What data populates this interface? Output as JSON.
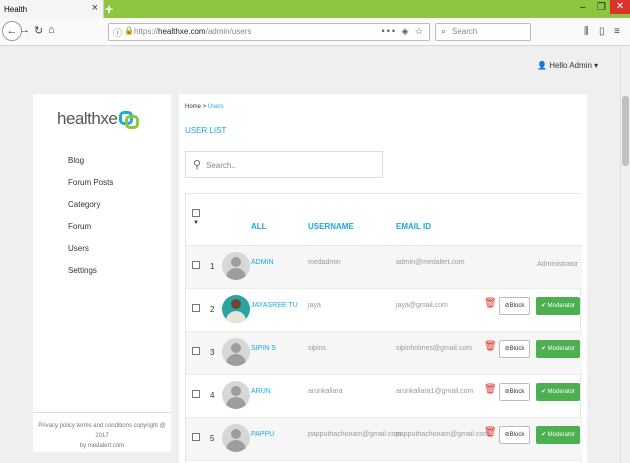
{
  "browser": {
    "tab_title": "Health",
    "tab_close": "×",
    "new_tab": "+",
    "url_prefix": "https://",
    "url_host": "healthxe.com",
    "url_path": "/admin/users",
    "url_actions": "••• ◈ ☆",
    "search_placeholder": "Search"
  },
  "header": {
    "greeting": "Hello Admin"
  },
  "sidebar": {
    "logo_text": "health",
    "logo_text_accent": "xe",
    "items": [
      {
        "label": "Blog"
      },
      {
        "label": "Forum Posts"
      },
      {
        "label": "Category"
      },
      {
        "label": "Forum"
      },
      {
        "label": "Users"
      },
      {
        "label": "Settings"
      }
    ],
    "footer_line1": "Privacy policy terms and conditions copyright @ 2017",
    "footer_line2": "by medalert.com"
  },
  "main": {
    "breadcrumb_home": "Home",
    "breadcrumb_sep": " > ",
    "breadcrumb_current": "Users",
    "title": "USER LIST",
    "search_placeholder": "Search.."
  },
  "table": {
    "headers": {
      "all": "ALL",
      "username": "USERNAME",
      "email": "EMAIL ID"
    },
    "rows": [
      {
        "num": "1",
        "name": "ADMIN",
        "username": "medadmin",
        "email": "admin@medalert.com",
        "role": "Administrator",
        "photo": false
      },
      {
        "num": "2",
        "name": "JAYASREE TU",
        "username": "jaya",
        "email": "jaya@gmail.com",
        "block": "Block",
        "moderator": "Moderator",
        "photo": true
      },
      {
        "num": "3",
        "name": "SIPIN S",
        "username": "sipins",
        "email": "sipinholmes@gmail.com",
        "block": "Block",
        "moderator": "Moderator",
        "photo": false
      },
      {
        "num": "4",
        "name": "ARUN",
        "username": "arunkallara",
        "email": "arunkallara1@gmail.com",
        "block": "Block",
        "moderator": "Moderator",
        "photo": false
      },
      {
        "num": "5",
        "name": "PAPPU",
        "username": "papputhachonam@gmail.com",
        "email": "papputhachonam@gmail.com",
        "block": "Block",
        "moderator": "Moderator",
        "photo": false
      }
    ]
  },
  "colors": {
    "accent": "#1aa9e0",
    "brand_green": "#8ec63f",
    "moderator_button": "#4caf50",
    "delete_icon": "#e0342c"
  }
}
